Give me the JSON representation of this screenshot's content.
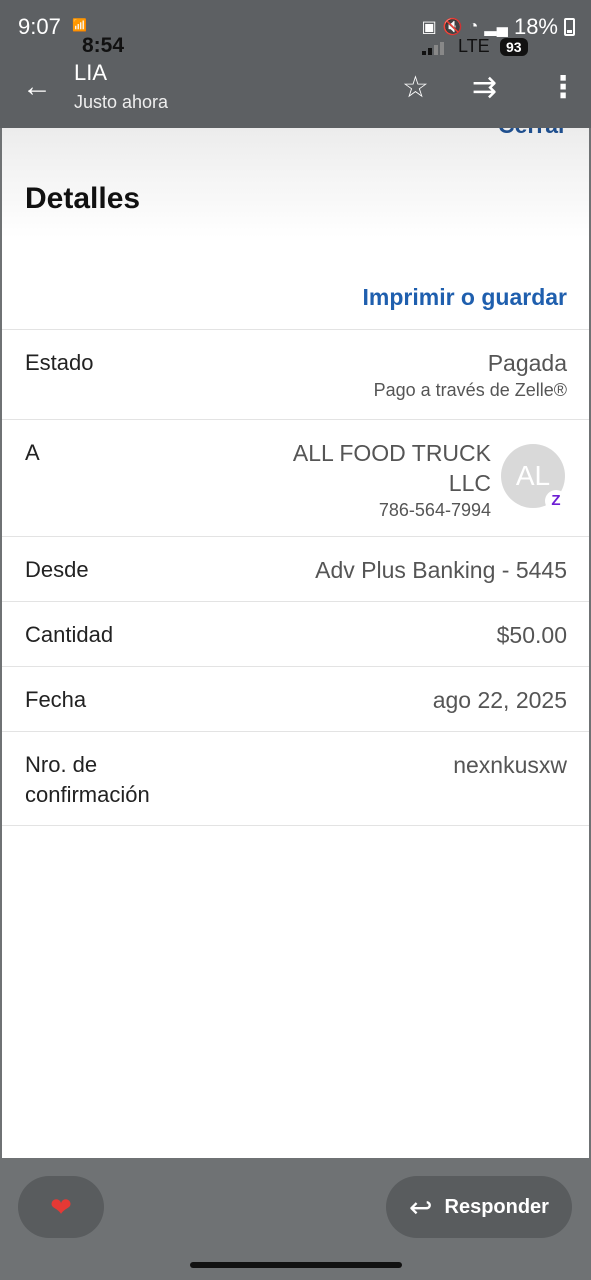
{
  "status_bar": {
    "time": "9:07",
    "battery": "18%"
  },
  "inner_status": {
    "time": "8:54",
    "network": "LTE",
    "battery": "93"
  },
  "email_header": {
    "sender": "LIA",
    "time_label": "Justo ahora"
  },
  "details": {
    "close_label": "Cerrar",
    "title": "Detalles",
    "print_label": "Imprimir o guardar",
    "estado": {
      "label": "Estado",
      "value": "Pagada",
      "sub": "Pago a través de Zelle®"
    },
    "to": {
      "label": "A",
      "name_line1": "ALL FOOD TRUCK",
      "name_line2": "LLC",
      "phone": "786-564-7994",
      "avatar_initials": "AL",
      "badge": "Z"
    },
    "from": {
      "label": "Desde",
      "value": "Adv Plus Banking - 5445"
    },
    "amount": {
      "label": "Cantidad",
      "value": "$50.00"
    },
    "date": {
      "label": "Fecha",
      "value": "ago 22, 2025"
    },
    "confirmation": {
      "label_line1": "Nro. de",
      "label_line2": "confirmación",
      "value": "nexnkusxw"
    }
  },
  "bottom": {
    "reply_label": "Responder"
  },
  "colors": {
    "accent_blue": "#1f5fae",
    "zelle_purple": "#6d1ed4"
  }
}
